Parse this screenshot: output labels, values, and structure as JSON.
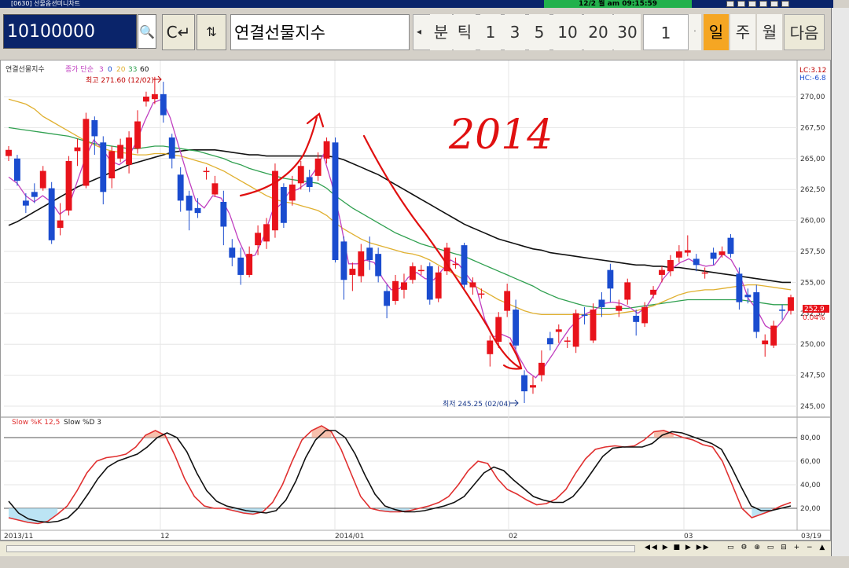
{
  "window": {
    "title": "[0630] 선물옵션미니차트",
    "clock": "12/2 월 am 09:15:59"
  },
  "toolbar": {
    "code": "10100000",
    "name": "연결선물지수",
    "mode_buttons": [
      "분",
      "틱",
      "1",
      "3",
      "5",
      "10",
      "20",
      "30"
    ],
    "count": "1",
    "period_buttons": [
      "일",
      "주",
      "월"
    ],
    "next": "다음",
    "active_period": "일"
  },
  "chart": {
    "legend_title": "연결선물지수",
    "legend_ma_label": "종가 단순",
    "legend_ma_values": [
      "3",
      "0",
      "20",
      "33",
      "60"
    ],
    "high_label": "최고 271.60 (12/02)",
    "low_label": "최저 245.25 (02/04)",
    "lc_label": "LC:3.12",
    "hc_label": "HC:-6.8",
    "price_label": "252.9",
    "change_label": "0.04%",
    "handwritten": "2014",
    "stoch_label_k": "Slow %K 12,5",
    "stoch_label_d": "Slow %D 3",
    "x_labels": [
      "2013/11",
      "12",
      "2014/01",
      "02",
      "03",
      "03/19"
    ],
    "colors": {
      "up": "#e8131b",
      "down": "#1a4ccf",
      "ma3": "#c03fc0",
      "ma20": "#e0b030",
      "ma33": "#30a050",
      "ma60": "#111111",
      "stoch_k": "#e03030",
      "stoch_d": "#111111"
    }
  },
  "chart_data": {
    "type": "candlestick",
    "y_ticks": [
      "270,00",
      "267,50",
      "265,00",
      "262,50",
      "260,00",
      "257,50",
      "255,00",
      "252,50",
      "250,00",
      "247,50",
      "245,00"
    ],
    "ylim": [
      244.5,
      272.5
    ],
    "stoch_ticks": [
      "80,00",
      "60,00",
      "40,00",
      "20,00"
    ],
    "candles": [
      {
        "o": 265.2,
        "c": 265.7,
        "h": 266.0,
        "l": 264.8
      },
      {
        "o": 265.0,
        "c": 263.2,
        "h": 265.3,
        "l": 262.8
      },
      {
        "o": 261.6,
        "c": 261.2,
        "h": 262.2,
        "l": 260.6
      },
      {
        "o": 262.3,
        "c": 261.9,
        "h": 263.0,
        "l": 261.4
      },
      {
        "o": 262.6,
        "c": 264.0,
        "h": 264.4,
        "l": 262.4
      },
      {
        "o": 262.6,
        "c": 258.4,
        "h": 263.1,
        "l": 258.1
      },
      {
        "o": 259.4,
        "c": 260.0,
        "h": 261.4,
        "l": 258.8
      },
      {
        "o": 260.8,
        "c": 264.8,
        "h": 265.2,
        "l": 260.4
      },
      {
        "o": 265.6,
        "c": 265.9,
        "h": 266.6,
        "l": 264.4
      },
      {
        "o": 262.8,
        "c": 268.2,
        "h": 268.7,
        "l": 262.6
      },
      {
        "o": 268.1,
        "c": 266.8,
        "h": 268.4,
        "l": 265.3
      },
      {
        "o": 266.3,
        "c": 262.3,
        "h": 266.8,
        "l": 261.3
      },
      {
        "o": 263.4,
        "c": 265.6,
        "h": 266.0,
        "l": 262.6
      },
      {
        "o": 265.0,
        "c": 266.1,
        "h": 266.6,
        "l": 264.7
      },
      {
        "o": 264.5,
        "c": 266.7,
        "h": 267.2,
        "l": 263.8
      },
      {
        "o": 265.8,
        "c": 268.0,
        "h": 268.9,
        "l": 265.4
      },
      {
        "o": 269.6,
        "c": 270.0,
        "h": 270.4,
        "l": 269.2
      },
      {
        "o": 269.8,
        "c": 270.2,
        "h": 271.6,
        "l": 269.4
      },
      {
        "o": 270.2,
        "c": 268.5,
        "h": 271.2,
        "l": 267.9
      },
      {
        "o": 266.7,
        "c": 265.0,
        "h": 267.0,
        "l": 264.2
      },
      {
        "o": 263.7,
        "c": 261.6,
        "h": 264.3,
        "l": 260.7
      },
      {
        "o": 262.0,
        "c": 260.8,
        "h": 262.4,
        "l": 259.2
      },
      {
        "o": 261.0,
        "c": 260.6,
        "h": 261.8,
        "l": 260.2
      },
      {
        "o": 264.0,
        "c": 264.0,
        "h": 264.3,
        "l": 263.3
      },
      {
        "o": 262.1,
        "c": 263.0,
        "h": 263.6,
        "l": 261.9
      },
      {
        "o": 261.5,
        "c": 259.5,
        "h": 262.4,
        "l": 258.0
      },
      {
        "o": 257.8,
        "c": 257.0,
        "h": 258.5,
        "l": 256.3
      },
      {
        "o": 257.0,
        "c": 255.6,
        "h": 257.8,
        "l": 254.8
      },
      {
        "o": 255.6,
        "c": 257.3,
        "h": 257.9,
        "l": 255.4
      },
      {
        "o": 258.0,
        "c": 259.0,
        "h": 259.6,
        "l": 257.2
      },
      {
        "o": 258.3,
        "c": 259.7,
        "h": 260.2,
        "l": 257.7
      },
      {
        "o": 259.2,
        "c": 264.0,
        "h": 264.6,
        "l": 258.6
      },
      {
        "o": 262.7,
        "c": 259.8,
        "h": 263.0,
        "l": 259.4
      },
      {
        "o": 261.6,
        "c": 262.9,
        "h": 263.6,
        "l": 261.2
      },
      {
        "o": 263.0,
        "c": 264.4,
        "h": 264.8,
        "l": 262.5
      },
      {
        "o": 263.5,
        "c": 262.7,
        "h": 264.1,
        "l": 262.3
      },
      {
        "o": 263.6,
        "c": 265.0,
        "h": 265.5,
        "l": 263.2
      },
      {
        "o": 265.0,
        "c": 266.4,
        "h": 266.7,
        "l": 264.6
      },
      {
        "o": 266.3,
        "c": 256.8,
        "h": 266.7,
        "l": 256.6
      },
      {
        "o": 258.3,
        "c": 255.2,
        "h": 258.7,
        "l": 253.6
      },
      {
        "o": 255.6,
        "c": 256.1,
        "h": 256.6,
        "l": 254.3
      },
      {
        "o": 255.5,
        "c": 257.5,
        "h": 258.1,
        "l": 255.0
      },
      {
        "o": 257.8,
        "c": 256.8,
        "h": 258.7,
        "l": 256.0
      },
      {
        "o": 257.3,
        "c": 255.5,
        "h": 257.8,
        "l": 255.0
      },
      {
        "o": 254.3,
        "c": 253.1,
        "h": 254.8,
        "l": 252.1
      },
      {
        "o": 253.5,
        "c": 255.1,
        "h": 255.6,
        "l": 253.2
      },
      {
        "o": 254.4,
        "c": 255.0,
        "h": 255.7,
        "l": 253.7
      },
      {
        "o": 255.2,
        "c": 256.3,
        "h": 256.6,
        "l": 254.9
      },
      {
        "o": 256.0,
        "c": 256.0,
        "h": 256.4,
        "l": 255.6
      },
      {
        "o": 256.3,
        "c": 253.6,
        "h": 256.6,
        "l": 253.2
      },
      {
        "o": 253.7,
        "c": 255.8,
        "h": 256.3,
        "l": 253.4
      },
      {
        "o": 255.9,
        "c": 257.8,
        "h": 258.2,
        "l": 255.6
      },
      {
        "o": 256.5,
        "c": 256.5,
        "h": 257.0,
        "l": 256.1
      },
      {
        "o": 258.0,
        "c": 254.8,
        "h": 258.2,
        "l": 254.4
      },
      {
        "o": 254.6,
        "c": 255.0,
        "h": 255.4,
        "l": 254.0
      },
      {
        "o": 254.1,
        "c": 254.1,
        "h": 254.5,
        "l": 253.7
      },
      {
        "o": 249.2,
        "c": 250.3,
        "h": 250.7,
        "l": 248.2
      },
      {
        "o": 250.2,
        "c": 252.2,
        "h": 252.6,
        "l": 249.7
      },
      {
        "o": 252.7,
        "c": 254.3,
        "h": 254.9,
        "l": 252.2
      },
      {
        "o": 252.8,
        "c": 249.9,
        "h": 253.6,
        "l": 249.6
      },
      {
        "o": 247.5,
        "c": 246.2,
        "h": 247.9,
        "l": 245.25
      },
      {
        "o": 246.5,
        "c": 246.7,
        "h": 247.4,
        "l": 246.0
      },
      {
        "o": 247.5,
        "c": 248.5,
        "h": 249.5,
        "l": 247.0
      },
      {
        "o": 250.5,
        "c": 250.0,
        "h": 251.0,
        "l": 249.5
      },
      {
        "o": 251.0,
        "c": 251.2,
        "h": 251.6,
        "l": 250.1
      },
      {
        "o": 250.3,
        "c": 250.3,
        "h": 250.6,
        "l": 249.7
      },
      {
        "o": 249.8,
        "c": 252.5,
        "h": 252.8,
        "l": 249.3
      },
      {
        "o": 252.4,
        "c": 252.3,
        "h": 253.0,
        "l": 251.6
      },
      {
        "o": 250.3,
        "c": 252.8,
        "h": 253.3,
        "l": 250.1
      },
      {
        "o": 253.6,
        "c": 253.0,
        "h": 254.2,
        "l": 252.2
      },
      {
        "o": 256.0,
        "c": 254.5,
        "h": 256.5,
        "l": 253.4
      },
      {
        "o": 252.7,
        "c": 253.1,
        "h": 253.6,
        "l": 252.2
      },
      {
        "o": 253.6,
        "c": 255.0,
        "h": 255.3,
        "l": 253.2
      },
      {
        "o": 252.3,
        "c": 251.8,
        "h": 252.8,
        "l": 250.7
      },
      {
        "o": 251.7,
        "c": 253.0,
        "h": 253.4,
        "l": 251.4
      },
      {
        "o": 254.0,
        "c": 254.4,
        "h": 254.7,
        "l": 253.7
      },
      {
        "o": 255.6,
        "c": 256.0,
        "h": 256.3,
        "l": 255.0
      },
      {
        "o": 255.9,
        "c": 256.8,
        "h": 257.2,
        "l": 255.5
      },
      {
        "o": 257.0,
        "c": 257.5,
        "h": 258.0,
        "l": 256.6
      },
      {
        "o": 257.4,
        "c": 257.6,
        "h": 258.8,
        "l": 257.1
      },
      {
        "o": 256.9,
        "c": 256.4,
        "h": 257.3,
        "l": 255.9
      },
      {
        "o": 255.8,
        "c": 255.8,
        "h": 256.2,
        "l": 255.3
      },
      {
        "o": 257.4,
        "c": 256.9,
        "h": 257.8,
        "l": 256.4
      },
      {
        "o": 257.2,
        "c": 257.5,
        "h": 257.9,
        "l": 257.0
      },
      {
        "o": 258.6,
        "c": 257.3,
        "h": 258.9,
        "l": 257.0
      },
      {
        "o": 255.7,
        "c": 253.4,
        "h": 256.2,
        "l": 252.8
      },
      {
        "o": 254.0,
        "c": 253.8,
        "h": 254.5,
        "l": 253.3
      },
      {
        "o": 254.2,
        "c": 251.0,
        "h": 254.8,
        "l": 250.5
      },
      {
        "o": 250.0,
        "c": 250.3,
        "h": 250.8,
        "l": 249.0
      },
      {
        "o": 249.9,
        "c": 251.5,
        "h": 251.9,
        "l": 249.7
      },
      {
        "o": 252.8,
        "c": 252.7,
        "h": 253.2,
        "l": 252.0
      },
      {
        "o": 252.7,
        "c": 253.8,
        "h": 254.0,
        "l": 252.4
      }
    ],
    "ma3": [
      263.5,
      263.0,
      262.0,
      261.5,
      262.0,
      261.5,
      260.5,
      261.0,
      263.0,
      265.0,
      266.5,
      265.8,
      264.8,
      264.5,
      265.0,
      266.3,
      268.0,
      269.5,
      269.8,
      268.3,
      266.0,
      263.7,
      261.6,
      261.0,
      262.0,
      261.8,
      260.5,
      258.5,
      257.0,
      257.2,
      258.7,
      260.7,
      261.3,
      262.3,
      262.5,
      263.0,
      264.0,
      265.3,
      263.0,
      260.0,
      256.5,
      256.5,
      256.8,
      256.6,
      255.3,
      254.4,
      254.5,
      255.4,
      255.8,
      255.3,
      255.2,
      256.0,
      256.8,
      256.4,
      255.5,
      254.6,
      252.0,
      250.6,
      250.8,
      250.5,
      249.0,
      247.8,
      247.3,
      248.2,
      249.2,
      250.3,
      251.3,
      252.0,
      252.5,
      252.8,
      253.3,
      253.4,
      253.3,
      253.0,
      252.5,
      253.0,
      254.1,
      255.3,
      256.1,
      256.6,
      256.9,
      256.5,
      256.3,
      256.4,
      257.3,
      256.8,
      255.6,
      253.7,
      252.8,
      251.5,
      251.1,
      251.9,
      253.0
    ],
    "ma20": [
      269.8,
      269.6,
      269.4,
      269.0,
      268.4,
      268.0,
      267.6,
      267.2,
      266.8,
      266.4,
      266.1,
      265.8,
      265.6,
      265.5,
      265.4,
      265.3,
      265.3,
      265.4,
      265.4,
      265.3,
      265.2,
      265.0,
      264.8,
      264.6,
      264.3,
      264.0,
      263.6,
      263.2,
      262.8,
      262.4,
      262.0,
      261.7,
      261.5,
      261.4,
      261.2,
      261.0,
      260.8,
      260.4,
      259.8,
      259.3,
      258.9,
      258.5,
      258.2,
      258.0,
      257.8,
      257.6,
      257.4,
      257.3,
      257.1,
      256.8,
      256.4,
      256.0,
      255.6,
      255.2,
      254.8,
      254.4,
      254.0,
      253.6,
      253.3,
      253.0,
      252.7,
      252.5,
      252.4,
      252.4,
      252.4,
      252.4,
      252.4,
      252.4,
      252.4,
      252.4,
      252.4,
      252.5,
      252.6,
      252.7,
      252.9,
      253.1,
      253.4,
      253.7,
      254.0,
      254.2,
      254.3,
      254.4,
      254.4,
      254.5,
      254.6,
      254.7,
      254.8,
      254.8,
      254.7,
      254.6,
      254.5,
      254.4
    ],
    "ma33": [
      267.5,
      267.4,
      267.3,
      267.2,
      267.1,
      267.0,
      266.9,
      266.8,
      266.6,
      266.4,
      266.2,
      266.1,
      266.0,
      265.9,
      265.8,
      265.8,
      265.9,
      266.0,
      266.0,
      265.9,
      265.8,
      265.7,
      265.6,
      265.4,
      265.2,
      265.0,
      264.7,
      264.5,
      264.2,
      264.0,
      263.8,
      263.6,
      263.4,
      263.3,
      263.2,
      263.1,
      263.0,
      262.6,
      262.0,
      261.5,
      261.0,
      260.6,
      260.2,
      259.8,
      259.4,
      259.0,
      258.7,
      258.4,
      258.1,
      257.9,
      257.7,
      257.5,
      257.3,
      257.1,
      256.8,
      256.5,
      256.2,
      255.9,
      255.6,
      255.3,
      255.0,
      254.7,
      254.3,
      254.0,
      253.7,
      253.5,
      253.3,
      253.1,
      253.0,
      252.9,
      252.9,
      252.9,
      252.9,
      253.0,
      253.1,
      253.2,
      253.3,
      253.4,
      253.5,
      253.6,
      253.6,
      253.6,
      253.6,
      253.6,
      253.6,
      253.6,
      253.5,
      253.4,
      253.3,
      253.2,
      253.2,
      253.2
    ],
    "ma60": [
      259.6,
      259.9,
      260.3,
      260.7,
      261.1,
      261.5,
      261.9,
      262.3,
      262.7,
      263.0,
      263.3,
      263.6,
      263.9,
      264.2,
      264.5,
      264.7,
      264.9,
      265.1,
      265.3,
      265.5,
      265.6,
      265.7,
      265.7,
      265.7,
      265.7,
      265.6,
      265.5,
      265.4,
      265.3,
      265.3,
      265.2,
      265.2,
      265.2,
      265.2,
      265.2,
      265.2,
      265.2,
      265.2,
      265.1,
      264.9,
      264.6,
      264.3,
      264.0,
      263.7,
      263.3,
      262.9,
      262.5,
      262.1,
      261.7,
      261.3,
      260.9,
      260.5,
      260.1,
      259.7,
      259.4,
      259.1,
      258.8,
      258.5,
      258.3,
      258.1,
      257.9,
      257.7,
      257.6,
      257.4,
      257.3,
      257.2,
      257.1,
      257.0,
      256.9,
      256.8,
      256.7,
      256.6,
      256.5,
      256.4,
      256.4,
      256.3,
      256.3,
      256.2,
      256.2,
      256.1,
      256.0,
      255.9,
      255.8,
      255.7,
      255.6,
      255.5,
      255.4,
      255.3,
      255.2,
      255.1,
      255.0,
      255.0
    ],
    "stoch_k": [
      12,
      10,
      8,
      7,
      9,
      15,
      22,
      35,
      50,
      60,
      63,
      64,
      66,
      72,
      82,
      86,
      82,
      65,
      45,
      30,
      22,
      20,
      20,
      18,
      16,
      15,
      17,
      25,
      40,
      60,
      78,
      86,
      90,
      85,
      70,
      50,
      30,
      20,
      18,
      17,
      17,
      18,
      20,
      22,
      25,
      30,
      40,
      52,
      60,
      58,
      45,
      36,
      32,
      27,
      23,
      24,
      28,
      36,
      50,
      62,
      70,
      72,
      73,
      72,
      73,
      78,
      85,
      86,
      83,
      80,
      78,
      74,
      72,
      60,
      40,
      20,
      12,
      15,
      18,
      22,
      25
    ],
    "stoch_d": [
      26,
      16,
      11,
      9,
      8,
      9,
      12,
      20,
      32,
      45,
      55,
      60,
      63,
      66,
      72,
      80,
      84,
      80,
      68,
      50,
      35,
      26,
      22,
      20,
      18,
      17,
      16,
      18,
      27,
      43,
      63,
      78,
      86,
      86,
      80,
      66,
      48,
      32,
      22,
      19,
      17,
      17,
      18,
      20,
      22,
      25,
      30,
      40,
      50,
      55,
      52,
      44,
      37,
      30,
      27,
      25,
      25,
      30,
      40,
      52,
      64,
      71,
      72,
      72,
      72,
      75,
      82,
      85,
      84,
      81,
      78,
      75,
      70,
      55,
      38,
      22,
      18,
      18,
      20,
      22
    ],
    "annotations": [
      "2014"
    ]
  }
}
